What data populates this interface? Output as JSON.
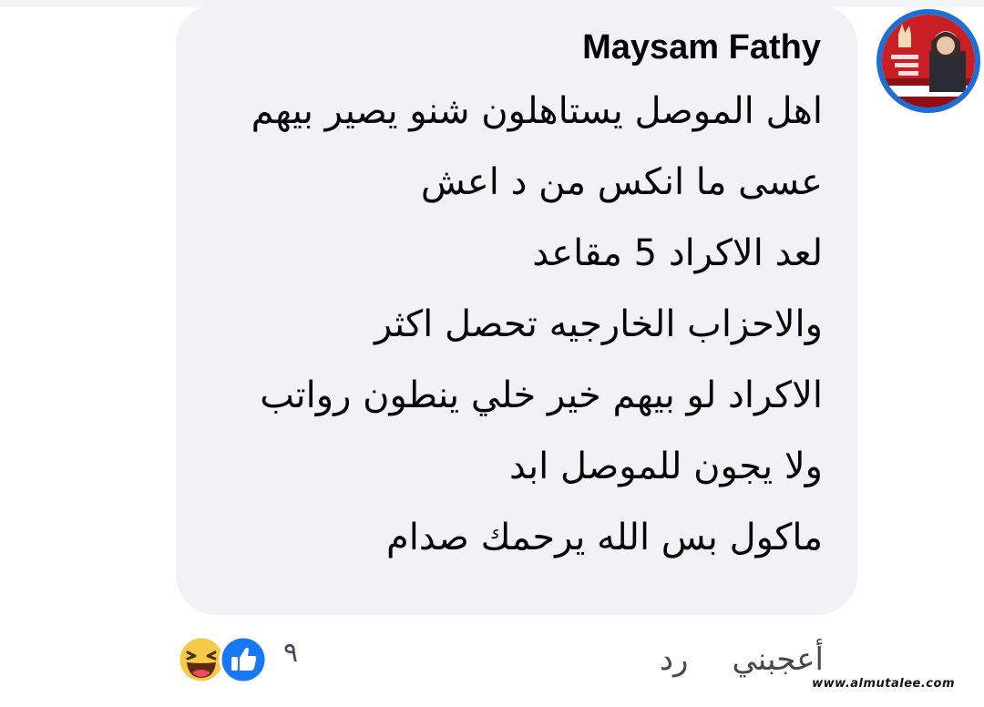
{
  "comment": {
    "author": "Maysam Fathy",
    "lines": [
      "اهل الموصل يستاهلون شنو يصير بيهم",
      "عسى ما انكس من د اعش",
      "لعد الاكراد 5 مقاعد",
      "والاحزاب الخارجيه تحصل اكثر",
      "الاكراد لو بيهم خير خلي ينطون رواتب",
      "ولا يجون للموصل ابد",
      "ماكول بس الله يرحمك صدام"
    ]
  },
  "reactions": {
    "count": "٩",
    "icons": [
      "haha-emoji-icon",
      "like-thumb-icon"
    ]
  },
  "actions": {
    "like_label": "أعجبني",
    "reply_label": "رد"
  },
  "watermark": "www.almutalee.com",
  "colors": {
    "bubble_background": "#f0f2f5",
    "avatar_ring": "#1b6fd6",
    "like_blue": "#1877f2",
    "haha_yellow": "#f7c948",
    "action_text": "#444950"
  }
}
